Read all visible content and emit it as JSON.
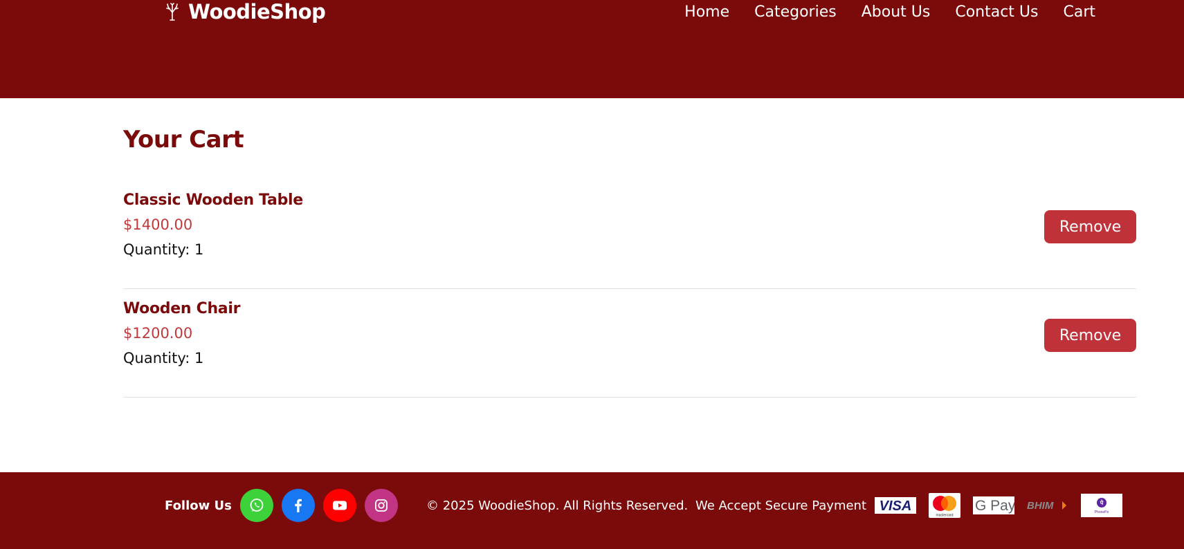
{
  "brand": {
    "name": "WoodieShop",
    "icon": "tree-icon"
  },
  "nav": {
    "items": [
      {
        "label": "Home"
      },
      {
        "label": "Categories"
      },
      {
        "label": "About Us"
      },
      {
        "label": "Contact Us"
      },
      {
        "label": "Cart"
      }
    ]
  },
  "page": {
    "title": "Your Cart"
  },
  "cart": {
    "items": [
      {
        "name": "Classic Wooden Table",
        "price": "$1400.00",
        "quantity": "Quantity: 1",
        "remove_label": "Remove"
      },
      {
        "name": "Wooden Chair",
        "price": "$1200.00",
        "quantity": "Quantity: 1",
        "remove_label": "Remove"
      }
    ]
  },
  "footer": {
    "follow_label": "Follow Us",
    "social": [
      {
        "icon": "whatsapp-icon",
        "color": "#3ed23a"
      },
      {
        "icon": "facebook-icon",
        "color": "#1877f2"
      },
      {
        "icon": "youtube-icon",
        "color": "#ff0000"
      },
      {
        "icon": "instagram-icon",
        "color": "#c13584"
      }
    ],
    "copyright": "© 2025 WoodieShop. All Rights Reserved.",
    "payment_label": "We Accept Secure Payment",
    "payment_logos": [
      {
        "icon": "visa-logo",
        "text": "VISA"
      },
      {
        "icon": "mastercard-logo",
        "text": "mastercard"
      },
      {
        "icon": "gpay-logo",
        "text": "G Pay"
      },
      {
        "icon": "bhim-logo",
        "text": "BHIM"
      },
      {
        "icon": "phonepe-logo",
        "text": "PhonePe"
      }
    ]
  },
  "colors": {
    "primary": "#7b0a0a",
    "accent": "#c0323a",
    "price": "#c0393b"
  }
}
